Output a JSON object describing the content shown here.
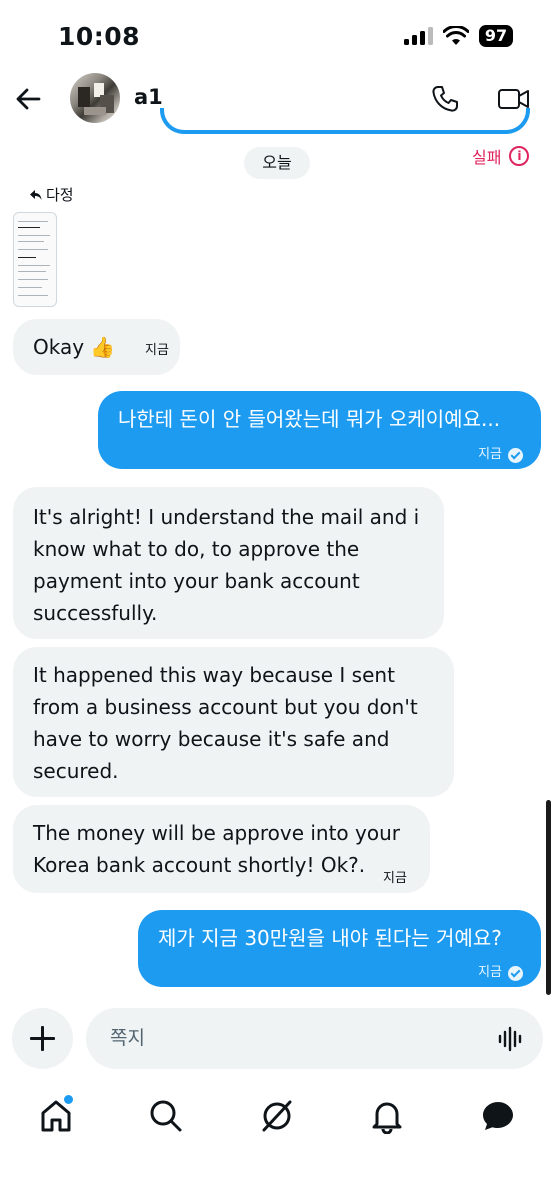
{
  "status_bar": {
    "time": "10:08",
    "battery": "97"
  },
  "header": {
    "name": "a1"
  },
  "date_pill": "오늘",
  "failed_label": "실패",
  "reply_label": "다정",
  "messages": [
    {
      "from": "them",
      "text": "Okay 👍",
      "time": "지금"
    },
    {
      "from": "me",
      "text": "나한테 돈이 안 들어왔는데 뭐가 오케이예요...",
      "time": "지금"
    },
    {
      "from": "them",
      "lines": [
        "It's alright! I understand the mail and i",
        "know what to do, to approve the",
        "payment into your bank account",
        "successfully."
      ]
    },
    {
      "from": "them",
      "lines": [
        "It happened this way because I sent",
        "from a business account but you don't",
        "have to worry because it's safe and",
        "secured."
      ]
    },
    {
      "from": "them",
      "lines": [
        "The money will be approve into your",
        "Korea bank account shortly! Ok?."
      ],
      "time": "지금"
    },
    {
      "from": "me",
      "text": "제가 지금 30만원을 내야 된다는 거예요?",
      "time": "지금"
    }
  ],
  "composer": {
    "placeholder": "쪽지"
  },
  "tabs": [
    "home-icon",
    "search-icon",
    "grok-icon",
    "notifications-icon",
    "messages-icon"
  ],
  "colors": {
    "accent": "#1d9bf0",
    "received_bubble": "#eff3f4",
    "error": "#e0245e"
  }
}
